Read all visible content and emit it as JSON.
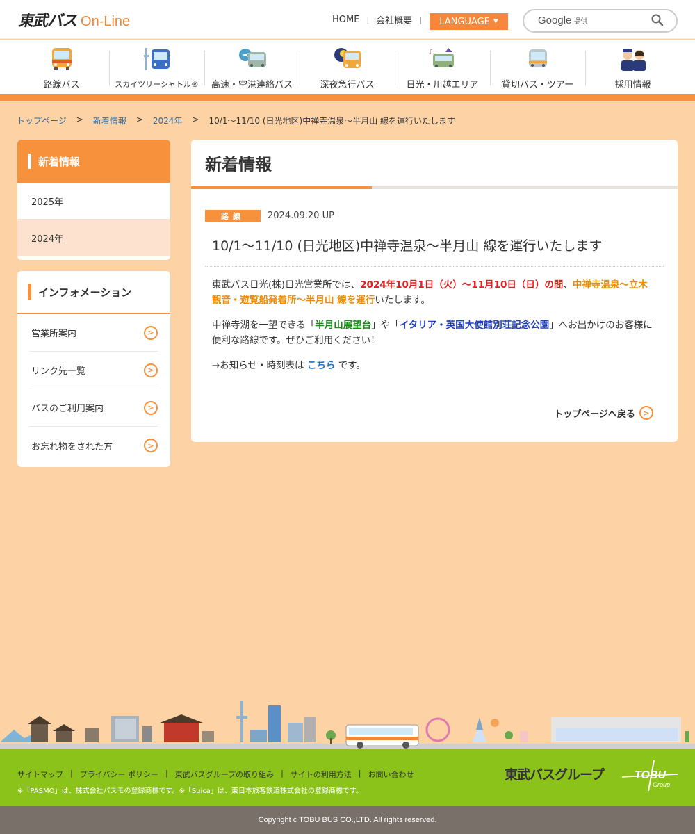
{
  "header": {
    "logo_main": "東武バス",
    "logo_sub": "On-Line",
    "nav": [
      "HOME",
      "会社概要"
    ],
    "language_label": "LANGUAGE",
    "search_brand": "Google",
    "search_brand_sub": "提供"
  },
  "gnav": [
    {
      "label": "路線バス",
      "icon": "bus-front-icon"
    },
    {
      "label": "スカイツリーシャトル®",
      "icon": "skytree-shuttle-icon"
    },
    {
      "label": "高速・空港連絡バス",
      "icon": "airport-bus-icon"
    },
    {
      "label": "深夜急行バス",
      "icon": "night-bus-icon"
    },
    {
      "label": "日光・川越エリア",
      "icon": "sightseeing-bus-icon"
    },
    {
      "label": "貸切バス・ツアー",
      "icon": "charter-bus-icon"
    },
    {
      "label": "採用情報",
      "icon": "staff-icon"
    }
  ],
  "breadcrumb": {
    "home": "トップページ",
    "news": "新着情報",
    "year": "2024年",
    "current": "10/1～11/10 (日光地区)中禅寺温泉～半月山 線を運行いたします"
  },
  "sidebar_news": {
    "title": "新着情報",
    "years": [
      "2025年",
      "2024年"
    ]
  },
  "sidebar_info": {
    "title": "インフォメーション",
    "items": [
      "営業所案内",
      "リンク先一覧",
      "バスのご利用案内",
      "お忘れ物をされた方"
    ]
  },
  "main": {
    "title": "新着情報",
    "category": "路線",
    "date": "2024.09.20 UP",
    "headline": "10/1～11/10 (日光地区)中禅寺温泉～半月山 線を運行いたします",
    "p1_a": "東武バス日光(株)日光営業所では、",
    "p1_red": "2024年10月1日（火）～11月10日（日）の間",
    "p1_sep": "、",
    "p1_orange": "中禅寺温泉～立木観音・遊覧船発着所～半月山 線を運行",
    "p1_b": "いたします。",
    "p2_a": "中禅寺湖を一望できる「",
    "p2_green": "半月山展望台",
    "p2_b": "」や「",
    "p2_blue": "イタリア・英国大使館別荘記念公園",
    "p2_c": "」へお出かけのお客様に便利な路線です。ぜひご利用ください！",
    "p3_a": "→お知らせ・時刻表は ",
    "p3_link": "こちら",
    "p3_b": " です。",
    "back_label": "トップページへ戻る"
  },
  "footer": {
    "links": [
      "サイトマップ",
      "プライバシー ポリシー",
      "東武バスグループの取り組み",
      "サイトの利用方法",
      "お問い合わせ"
    ],
    "note": "※「PASMO」は、株式会社パスモの登録商標です。※「Suica」は、東日本旅客鉄道株式会社の登録商標です。",
    "group_name": "東武バスグループ",
    "tobu_logo": "TOBU",
    "tobu_logo_sub": "Group",
    "copyright": "Copyright c TOBU BUS CO.,LTD. All rights reserved."
  }
}
